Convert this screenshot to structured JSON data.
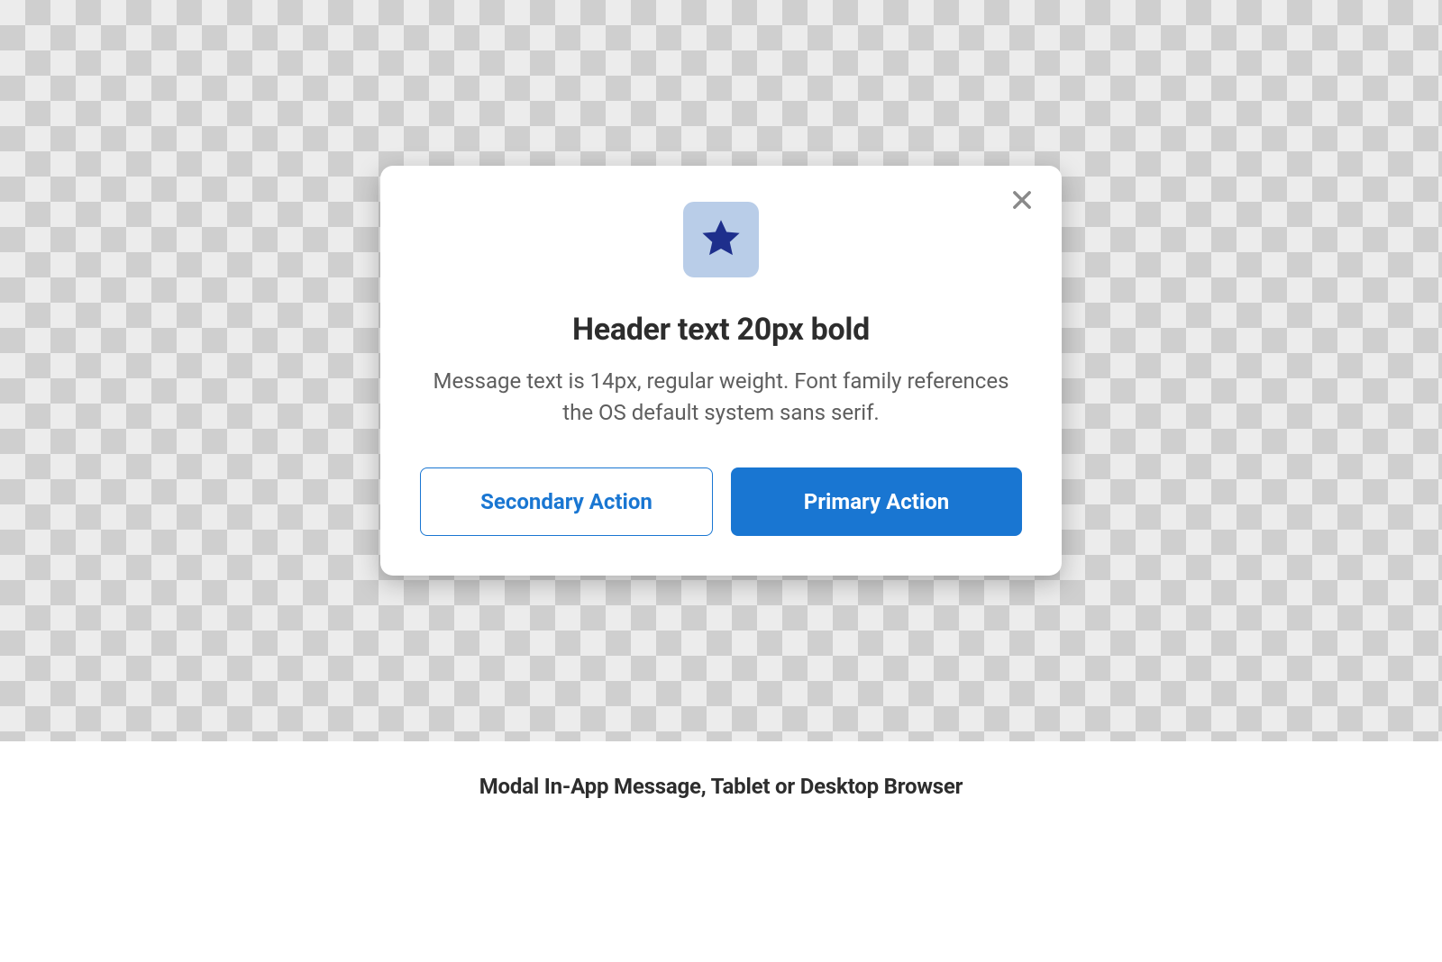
{
  "modal": {
    "icon": "star-icon",
    "header": "Header text 20px bold",
    "message": "Message text is 14px, regular weight. Font family references the OS default system sans serif.",
    "buttons": {
      "secondary": "Secondary Action",
      "primary": "Primary Action"
    }
  },
  "caption": "Modal In-App Message, Tablet or Desktop Browser",
  "colors": {
    "icon_tile_bg": "#b9cde8",
    "star_fill": "#1e2f8c",
    "primary_blue": "#1976d2",
    "text_dark": "#2d2d2d",
    "text_muted": "#5e5e5e",
    "close_icon": "#8a8a8a"
  }
}
